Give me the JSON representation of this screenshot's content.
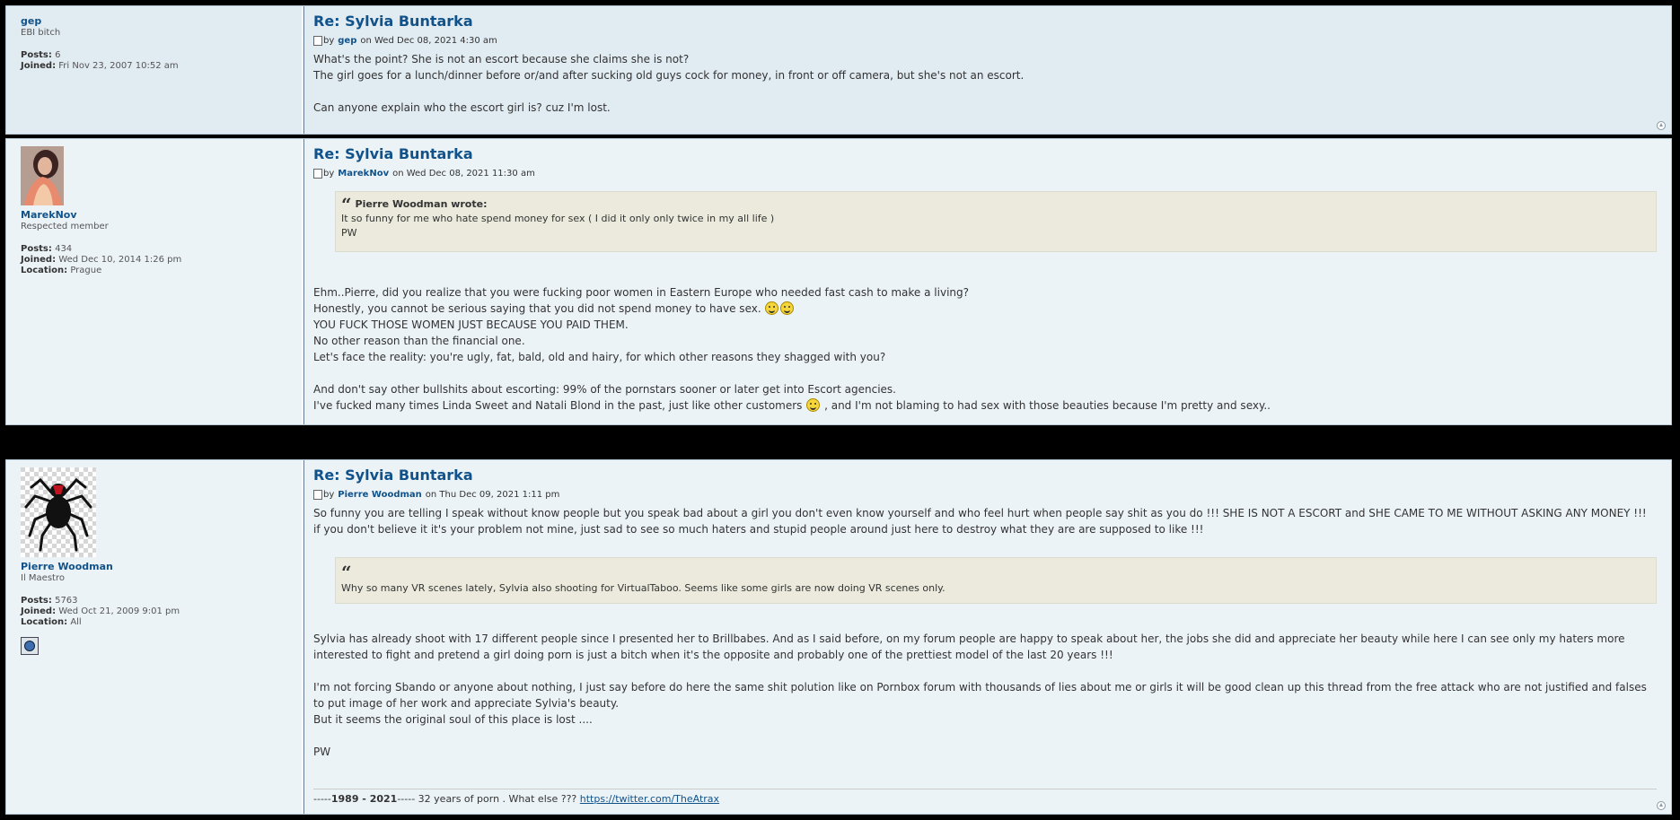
{
  "posts": [
    {
      "username": "gep",
      "rank": "EBI bitch",
      "posts_label": "Posts:",
      "posts": "6",
      "joined_label": "Joined:",
      "joined": "Fri Nov 23, 2007 10:52 am",
      "title": "Re: Sylvia Buntarka",
      "by": "by",
      "author": "gep",
      "on": "on Wed Dec 08, 2021 4:30 am",
      "lines": [
        "What's the point? She is not an escort because she claims she is not?",
        "The girl goes for a lunch/dinner before or/and after sucking old guys cock for money, in front or off camera, but she's not an escort.",
        "",
        "Can anyone explain who the escort girl is? cuz I'm lost."
      ]
    },
    {
      "username": "MarekNov",
      "rank": "Respected member",
      "posts_label": "Posts:",
      "posts": "434",
      "joined_label": "Joined:",
      "joined": "Wed Dec 10, 2014 1:26 pm",
      "location_label": "Location:",
      "location": "Prague",
      "title": "Re: Sylvia Buntarka",
      "by": "by",
      "author": "MarekNov",
      "on": "on Wed Dec 08, 2021 11:30 am",
      "quote_cite": "Pierre Woodman wrote:",
      "quote_lines": [
        "It so funny for me who hate spend money for sex ( I did it only only twice in my all life )",
        "PW"
      ],
      "line1": "Ehm..Pierre, did you realize that you were fucking poor women in Eastern Europe who needed fast cash to make a living?",
      "line2": "Honestly, you cannot be serious saying that you did not spend money to have sex.",
      "line3": "YOU FUCK THOSE WOMEN JUST BECAUSE YOU PAID THEM.",
      "line4": "No other reason than the financial one.",
      "line5": "Let's face the reality: you're ugly, fat, bald, old and hairy, for which other reasons they shagged with you?",
      "line6": "And don't say other bullshits about escorting: 99% of the pornstars sooner or later get into Escort agencies.",
      "line7a": "I've fucked many times Linda Sweet and Natali Blond in the past, just like other customers",
      "line7b": ", and I'm not blaming to had sex with those beauties because I'm pretty and sexy.."
    },
    {
      "username": "Pierre Woodman",
      "rank": "Il Maestro",
      "posts_label": "Posts:",
      "posts": "5763",
      "joined_label": "Joined:",
      "joined": "Wed Oct 21, 2009 9:01 pm",
      "location_label": "Location:",
      "location": "All",
      "title": "Re: Sylvia Buntarka",
      "by": "by",
      "author": "Pierre Woodman",
      "on": "on Thu Dec 09, 2021 1:11 pm",
      "para1": "So funny you are telling I speak without know people but you speak bad about a girl you don't even know yourself and who feel hurt when people say shit as you do !!! SHE IS NOT A ESCORT and SHE CAME TO ME WITHOUT ASKING ANY MONEY !!! if you don't believe it it's your problem not mine, just sad to see so much haters and stupid people around just here to destroy what they are are supposed to like !!!",
      "quote_line": "Why so many VR scenes lately, Sylvia also shooting for VirtualTaboo. Seems like some girls are now doing VR scenes only.",
      "para2": "Sylvia has already shoot with 17 different people since I presented her to Brillbabes. And as I said before, on my forum people are happy to speak about her, the jobs she did and appreciate her beauty while here I can see only my haters more interested to fight and pretend a girl doing porn is just a bitch when it's the opposite and probably one of the prettiest model of the last 20 years !!!",
      "para3": "I'm not forcing Sbando or anyone about nothing, I just say before do here the same shit polution like on Pornbox forum with thousands of lies about me or girls it will be good clean up this thread from the free attack who are not justified and falses to put image of her work and appreciate Sylvia's beauty.",
      "para4": "But it seems the original soul of this place is lost ....",
      "para5": "PW",
      "sig_prefix": "-----",
      "sig_years": "1989 - 2021",
      "sig_mid": "----- 32 years of porn . What else ??? ",
      "sig_link": "https://twitter.com/TheAtrax"
    }
  ],
  "icons": {
    "post_icon": "post-icon",
    "top": "back-to-top-icon",
    "smiley": "smiley-icon",
    "website": "website-icon"
  },
  "colors": {
    "link": "#105289",
    "bg1": "#e1ebf2",
    "bg2": "#ecf3f7",
    "quote": "#ebeadd"
  }
}
